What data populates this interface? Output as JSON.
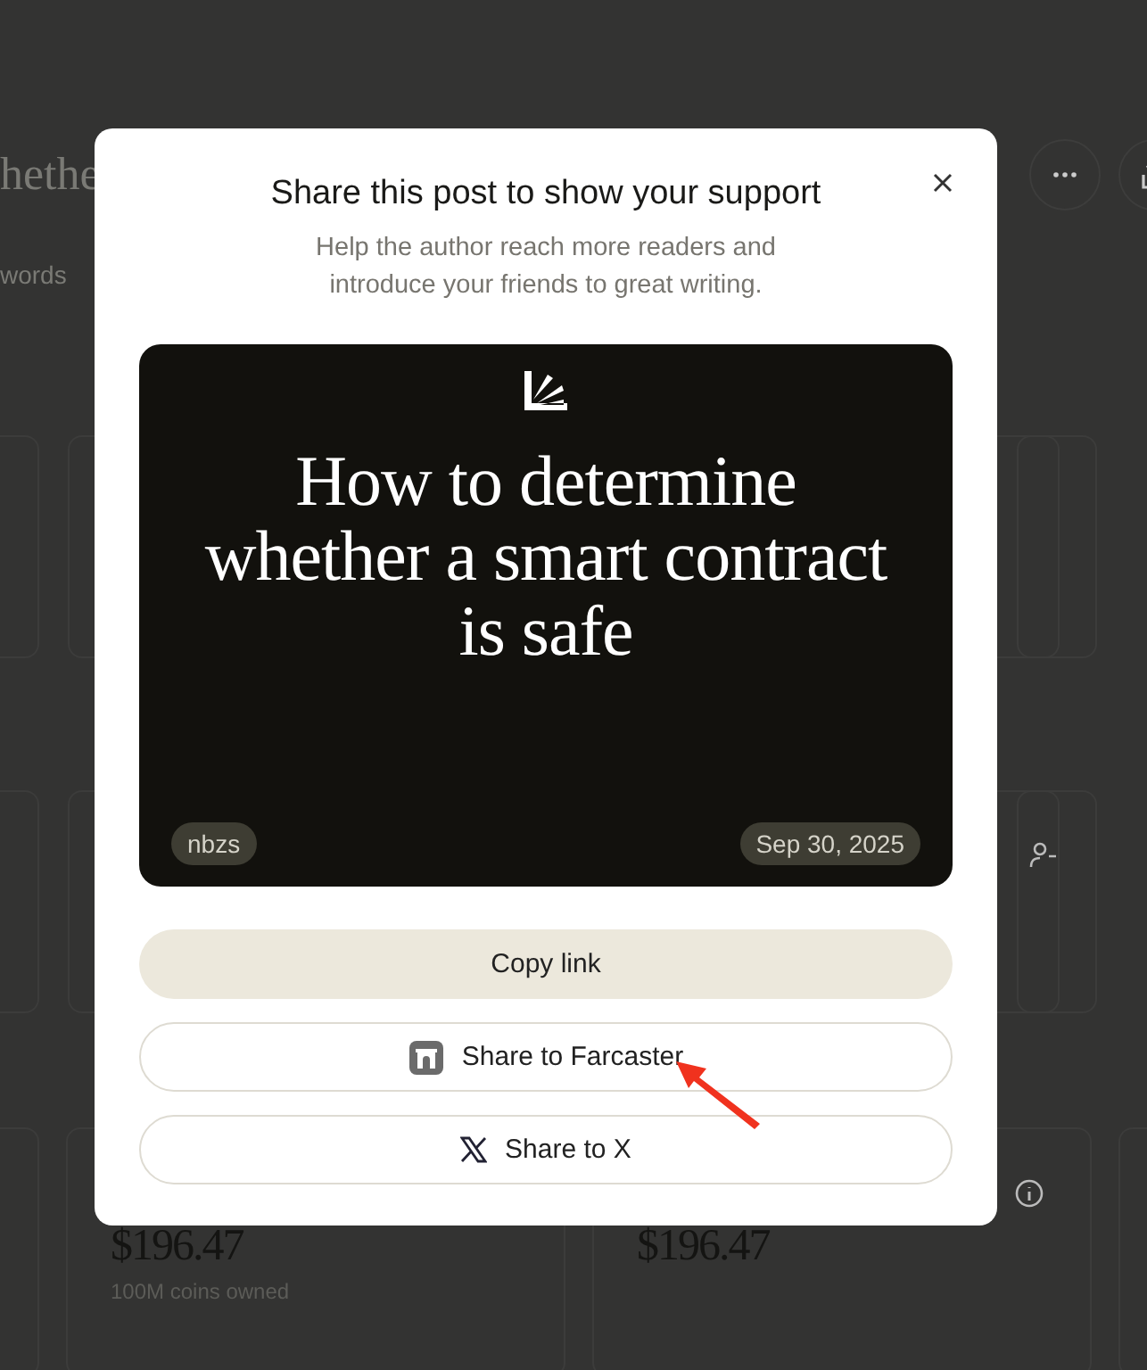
{
  "background": {
    "title_fragment": "hethe",
    "subtitle_fragment": "words",
    "holdings": [
      {
        "amount": "$196.47",
        "caption": "100M coins owned"
      },
      {
        "amount": "$196.47"
      }
    ]
  },
  "modal": {
    "title": "Share this post to show your support",
    "subtitle": "Help the author reach more readers and introduce your friends to great writing.",
    "preview": {
      "title": "How to determine whether a smart contract is safe",
      "author": "nbzs",
      "date": "Sep 30, 2025"
    },
    "buttons": [
      {
        "label": "Copy link",
        "kind": "primary"
      },
      {
        "label": "Share to Farcaster",
        "kind": "farcaster"
      },
      {
        "label": "Share to X",
        "kind": "x"
      }
    ]
  }
}
